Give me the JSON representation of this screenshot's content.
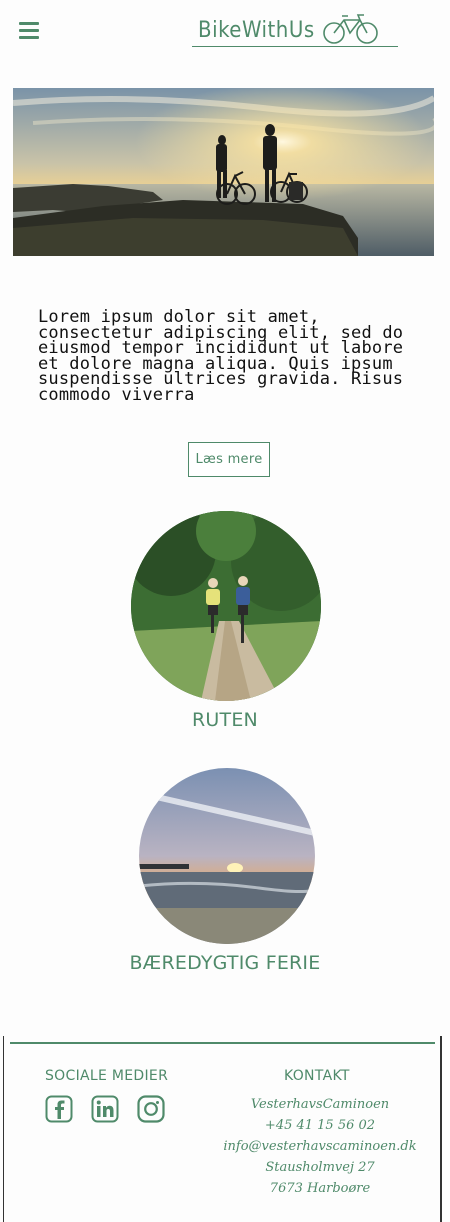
{
  "header": {
    "menu_icon": "hamburger-menu-icon",
    "logo_text": "BikeWithUs",
    "logo_icon": "bicycle-icon"
  },
  "intro": {
    "text": "Lorem ipsum dolor sit amet, consectetur adipiscing elit, sed do eiusmod tempor incididunt ut labore et dolore magna aliqua. Quis ipsum suspendisse ultrices gravida. Risus commodo viverra"
  },
  "buttons": {
    "read_more": "Læs mere"
  },
  "sections": [
    {
      "caption": "RUTEN"
    },
    {
      "caption": "BÆREDYGTIG FERIE"
    }
  ],
  "footer": {
    "social_title": "SOCIALE MEDIER",
    "social_icons": [
      "facebook-icon",
      "linkedin-icon",
      "instagram-icon"
    ],
    "contact_title": "KONTAKT",
    "contact_lines": [
      "VesterhavsCaminoen",
      "+45 41 15 56 02",
      "info@vesterhavscaminoen.dk",
      "Stausholmvej 27",
      "7673 Harboøre"
    ]
  },
  "colors": {
    "accent": "#4f8a6a"
  }
}
